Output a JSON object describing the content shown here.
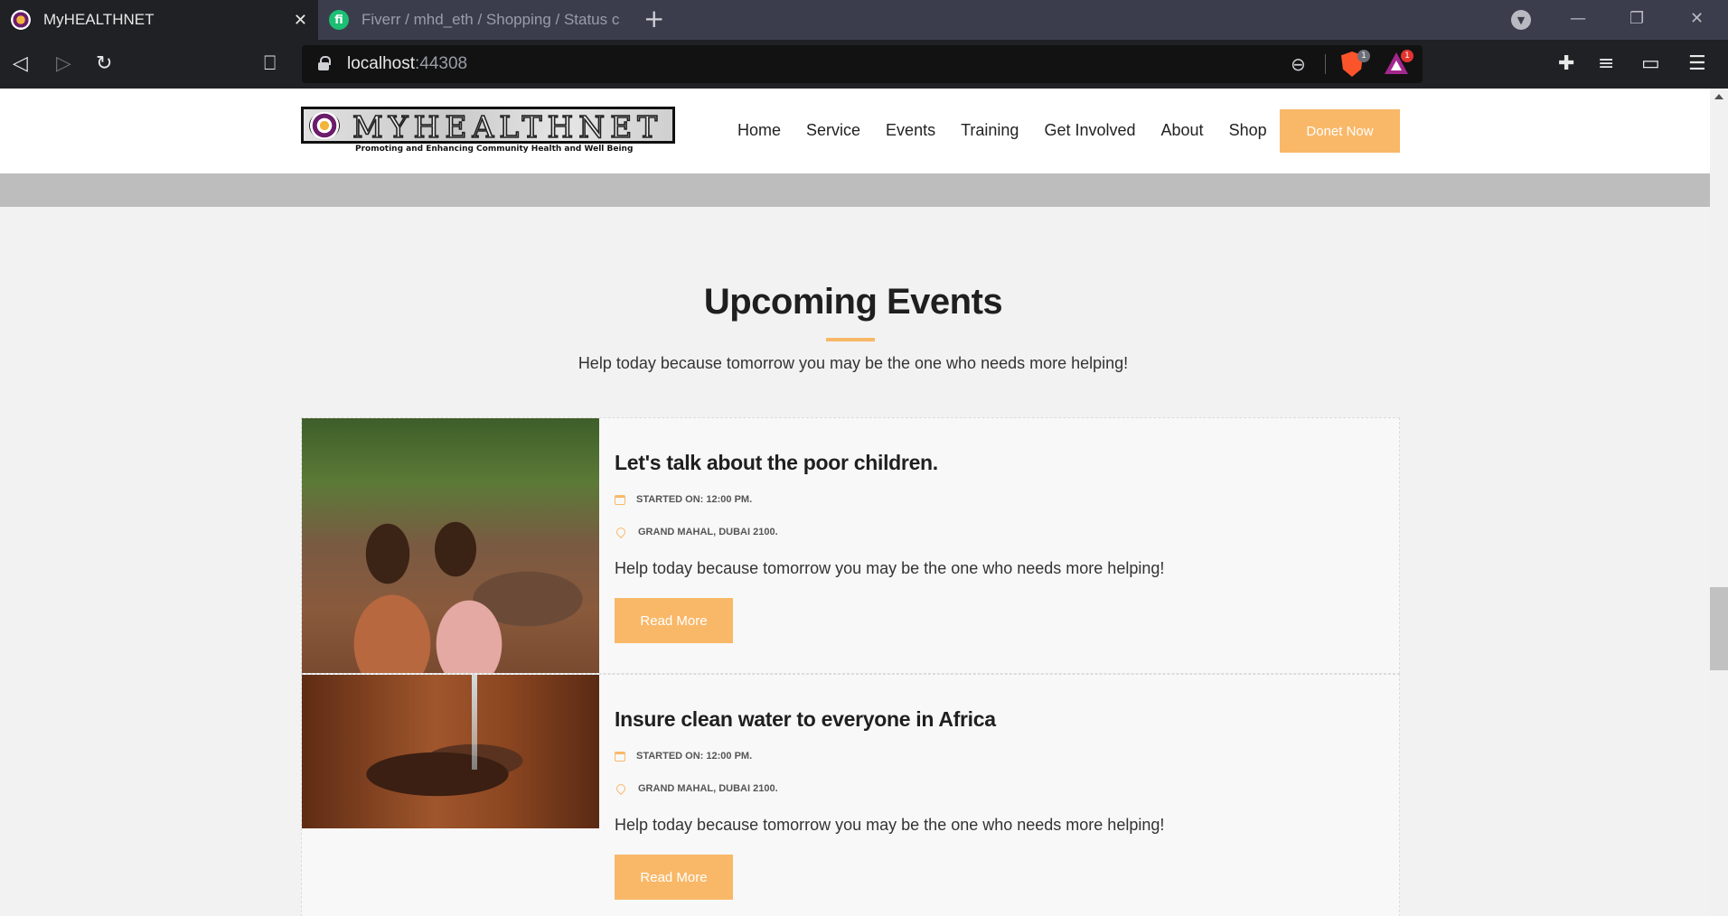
{
  "browser": {
    "tabs": [
      {
        "title": "MyHEALTHNET",
        "active": true,
        "favicon": "myhealthnet-favicon"
      },
      {
        "title": "Fiverr / mhd_eth / Shopping / Status c",
        "active": false,
        "favicon": "fiverr-favicon"
      }
    ],
    "fiverr_glyph": "fi",
    "url_host": "localhost",
    "url_port": ":44308",
    "shield_badge": "1",
    "rewards_badge": "1"
  },
  "header": {
    "logo_text": "MYHEALTHNET",
    "logo_tagline": "Promoting and Enhancing Community Health and Well Being",
    "nav": [
      "Home",
      "Service",
      "Events",
      "Training",
      "Get Involved",
      "About",
      "Shop"
    ],
    "donate_label": "Donet Now"
  },
  "section": {
    "title": "Upcoming Events",
    "subtitle": "Help today because tomorrow you may be the one who needs more helping!"
  },
  "events": [
    {
      "title": "Let's talk about the poor children.",
      "started": "STARTED ON: 12:00 PM.",
      "location": "GRAND MAHAL, DUBAI 2100.",
      "description": "Help today because tomorrow you may be the one who needs more helping!",
      "button": "Read More"
    },
    {
      "title": "Insure clean water to everyone in Africa",
      "started": "STARTED ON: 12:00 PM.",
      "location": "GRAND MAHAL, DUBAI 2100.",
      "description": "Help today because tomorrow you may be the one who needs more helping!",
      "button": "Read More"
    }
  ],
  "colors": {
    "accent": "#f9b868",
    "tabbar": "#3b3d4d",
    "toolbar": "#202124",
    "page_bg": "#f2f2f2"
  }
}
